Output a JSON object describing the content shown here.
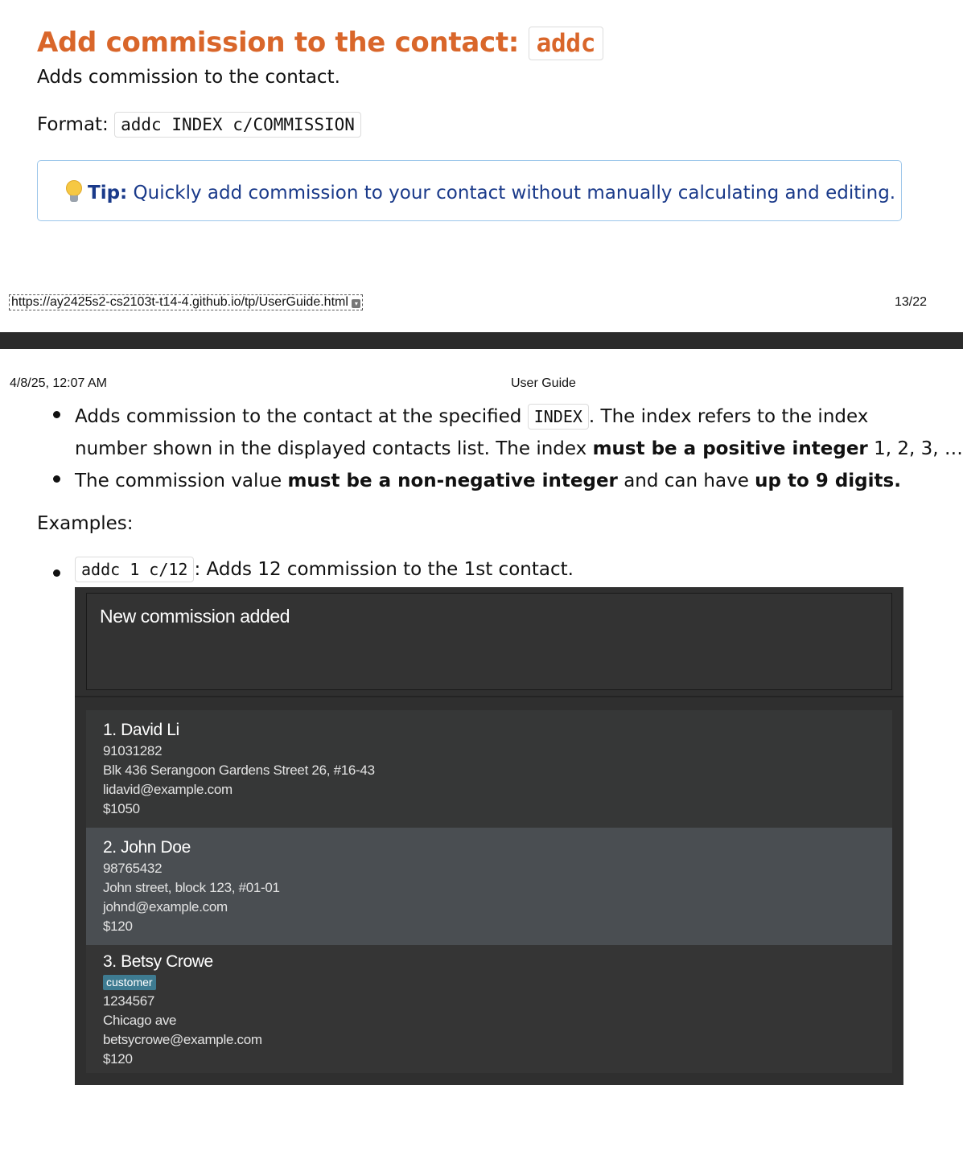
{
  "heading": {
    "text": "Add commission to the contact: ",
    "code": "addc"
  },
  "description": "Adds commission to the contact.",
  "format": {
    "label": "Format: ",
    "code": "addc INDEX c/COMMISSION"
  },
  "tip": {
    "label": "Tip:",
    "text": " Quickly add commission to your contact without manually calculating and editing.",
    "icon": "lightbulb-icon"
  },
  "print_footer": {
    "url": "https://ay2425s2-cs2103t-t14-4.github.io/tp/UserGuide.html",
    "page": "13/22"
  },
  "print_header": {
    "date": "4/8/25, 12:07 AM",
    "title": "User Guide"
  },
  "rules": [
    {
      "t1": "Adds commission to the contact at the specified ",
      "code": "INDEX",
      "t2": ". The index refers to the index",
      "t3": "number shown in the displayed contacts list. The index ",
      "b1": "must be a positive integer",
      "t4": " 1, 2, 3, …"
    },
    {
      "t1": "The commission value ",
      "b1": "must be a non-negative integer",
      "t2": " and can have ",
      "b2": "up to 9 digits."
    }
  ],
  "examples_label": "Examples:",
  "example": {
    "code": "addc 1 c/12",
    "text": ": Adds 12 commission to the 1st contact."
  },
  "screenshot": {
    "result": "New commission added",
    "contacts": [
      {
        "name": "1. David Li",
        "phone": "91031282",
        "address": "Blk 436 Serangoon Gardens Street 26, #16-43",
        "email": "lidavid@example.com",
        "commission": "$1050"
      },
      {
        "name": "2. John Doe",
        "phone": "98765432",
        "address": "John street, block 123, #01-01",
        "email": "johnd@example.com",
        "commission": "$120"
      },
      {
        "name": "3. Betsy Crowe",
        "tag": "customer",
        "phone": "1234567",
        "address": "Chicago ave",
        "email": "betsycrowe@example.com",
        "commission": "$120"
      }
    ]
  },
  "colors": {
    "heading": "#d9662a",
    "tip_text": "#1a3a8a",
    "tip_border": "#9cc6ea",
    "app_bg": "#2f2f2f",
    "selected_card": "#4a4e52",
    "tag_bg": "#3e7b91"
  }
}
